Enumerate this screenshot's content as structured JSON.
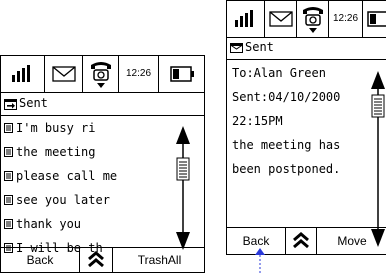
{
  "status_bar": {
    "time": "12:26"
  },
  "icons": {
    "signal": "signal-strength-icon",
    "message": "envelope-icon",
    "phone": "telephone-icon",
    "battery": "battery-icon",
    "up": "double-chevron-up-icon"
  },
  "inbox_screen": {
    "title": "Sent",
    "messages": [
      "I'm busy ri",
      "the meeting",
      "please call me",
      "see you later",
      "thank you",
      "I will be th"
    ],
    "softkeys": {
      "left": "Back",
      "right": "TrashAll"
    }
  },
  "detail_screen": {
    "title": "Sent",
    "lines": [
      "To:Alan Green",
      "Sent:04/10/2000",
      "22:15PM",
      "the meeting has",
      "been postponed."
    ],
    "softkeys": {
      "left": "Back",
      "right": "Move"
    }
  },
  "colors": {
    "cursor": "#2a3ad9",
    "foreground": "#000000",
    "background": "#ffffff"
  }
}
